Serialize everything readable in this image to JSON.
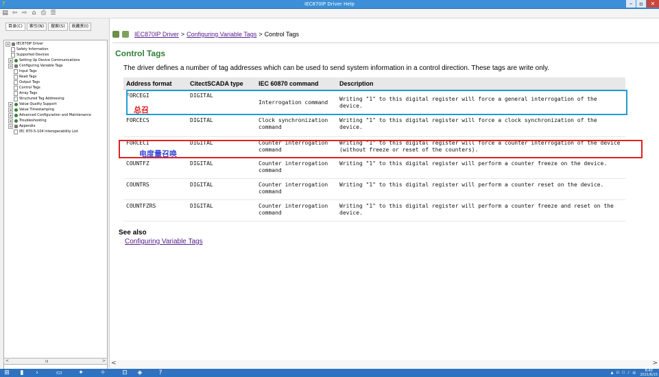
{
  "window": {
    "title": "IEC870IP Driver Help",
    "minimize": "–",
    "maximize": "▫",
    "close": "✕"
  },
  "toolbar": {
    "icons": [
      "contents-pane",
      "back",
      "forward",
      "home",
      "print",
      "options"
    ],
    "glyphs": [
      "▤",
      "⇦",
      "⇨",
      "⌂",
      "⎙",
      "☰"
    ]
  },
  "nav": {
    "tabs": [
      "目录(C)",
      "索引(N)",
      "搜索(S)",
      "收藏夹(I)"
    ],
    "tree": [
      {
        "label": "IEC870IP Driver",
        "exp": "⊟",
        "icon": "book",
        "indent": 0
      },
      {
        "label": "Safety Information",
        "icon": "page",
        "indent": 2
      },
      {
        "label": "Supported Devices",
        "icon": "page",
        "indent": 2
      },
      {
        "label": "Setting Up Device Communications",
        "exp": "⊞",
        "icon": "topic",
        "indent": 1
      },
      {
        "label": "Configuring Variable Tags",
        "exp": "⊟",
        "icon": "book",
        "indent": 1
      },
      {
        "label": "Input Tags",
        "icon": "page",
        "indent": 3
      },
      {
        "label": "Read Tags",
        "icon": "page",
        "indent": 3
      },
      {
        "label": "Output Tags",
        "icon": "page",
        "indent": 3
      },
      {
        "label": "Control Tags",
        "icon": "page",
        "indent": 3
      },
      {
        "label": "Array Tags",
        "icon": "page",
        "indent": 3
      },
      {
        "label": "Structured Tag Addressing",
        "icon": "page",
        "indent": 3
      },
      {
        "label": "Value Quality Support",
        "exp": "⊞",
        "icon": "topic",
        "indent": 1
      },
      {
        "label": "Value Timestamping",
        "exp": "⊞",
        "icon": "topic",
        "indent": 1
      },
      {
        "label": "Advanced Configuration and Maintenance",
        "exp": "⊞",
        "icon": "topic",
        "indent": 1
      },
      {
        "label": "Troubleshooting",
        "exp": "⊞",
        "icon": "topic",
        "indent": 1
      },
      {
        "label": "Appendix",
        "exp": "⊟",
        "icon": "book",
        "indent": 1
      },
      {
        "label": "IEC 870-5-104 Interoperability List",
        "icon": "page",
        "indent": 3
      }
    ],
    "scroll": {
      "left": "<",
      "right": ">",
      "thumb": "III"
    }
  },
  "breadcrumb": {
    "link1": "IEC870IP Driver",
    "sep1": ">",
    "link2": "Configuring Variable Tags",
    "sep2": ">",
    "current": "Control Tags"
  },
  "content": {
    "heading": "Control Tags",
    "intro": "The driver defines a number of tag addresses which can be used to send system information in a control direction. These tags are write only.",
    "table": {
      "headers": [
        "Address format",
        "CitectSCADA type",
        "IEC 60870 command",
        "Description"
      ],
      "rows": [
        [
          "FORCEGI",
          "DIGITAL",
          "Interrogation command",
          "Writing \"1\" to this digital register will force a general interrogation of the device."
        ],
        [
          "FORCECS",
          "DIGITAL",
          "Clock synchronization command",
          "Writing \"1\" to this digital register will force a clock synchronization of the device."
        ],
        [
          "FORCECI",
          "DIGITAL",
          "Counter interrogation command",
          "Writing \"1\" to this digital register will force a counter interrogation of the device (without freeze or reset of the counters)."
        ],
        [
          "COUNTFZ",
          "DIGITAL",
          "Counter interrogation command",
          "Writing \"1\" to this digital register will perform a counter freeze on the device."
        ],
        [
          "COUNTRS",
          "DIGITAL",
          "Counter interrogation command",
          "Writing \"1\" to this digital register will perform a counter reset on the device."
        ],
        [
          "COUNTFZRS",
          "DIGITAL",
          "Counter interrogation command",
          "Writing \"1\" to this digital register will perform a counter freeze and reset on the device."
        ]
      ]
    },
    "annotation_red": "总召",
    "annotation_blue": "电度量召唤",
    "see_also": "See also",
    "see_also_link": "Configuring Variable Tags",
    "scroll_left": "<",
    "scroll_right": ">"
  },
  "taskbar": {
    "icons": [
      "start",
      "server-manager",
      "powershell",
      "file-explorer",
      "app-tool",
      "app-run",
      "iec-help",
      "tool2",
      "help"
    ],
    "glyphs": [
      "⊞",
      "▮",
      "›",
      "▭",
      "✦",
      "✧",
      "⊡",
      "◈",
      "?"
    ],
    "tray": [
      "▲",
      "⊡",
      "☐",
      "♪",
      "中"
    ],
    "time": "8:40",
    "date": "2021/6/15"
  }
}
